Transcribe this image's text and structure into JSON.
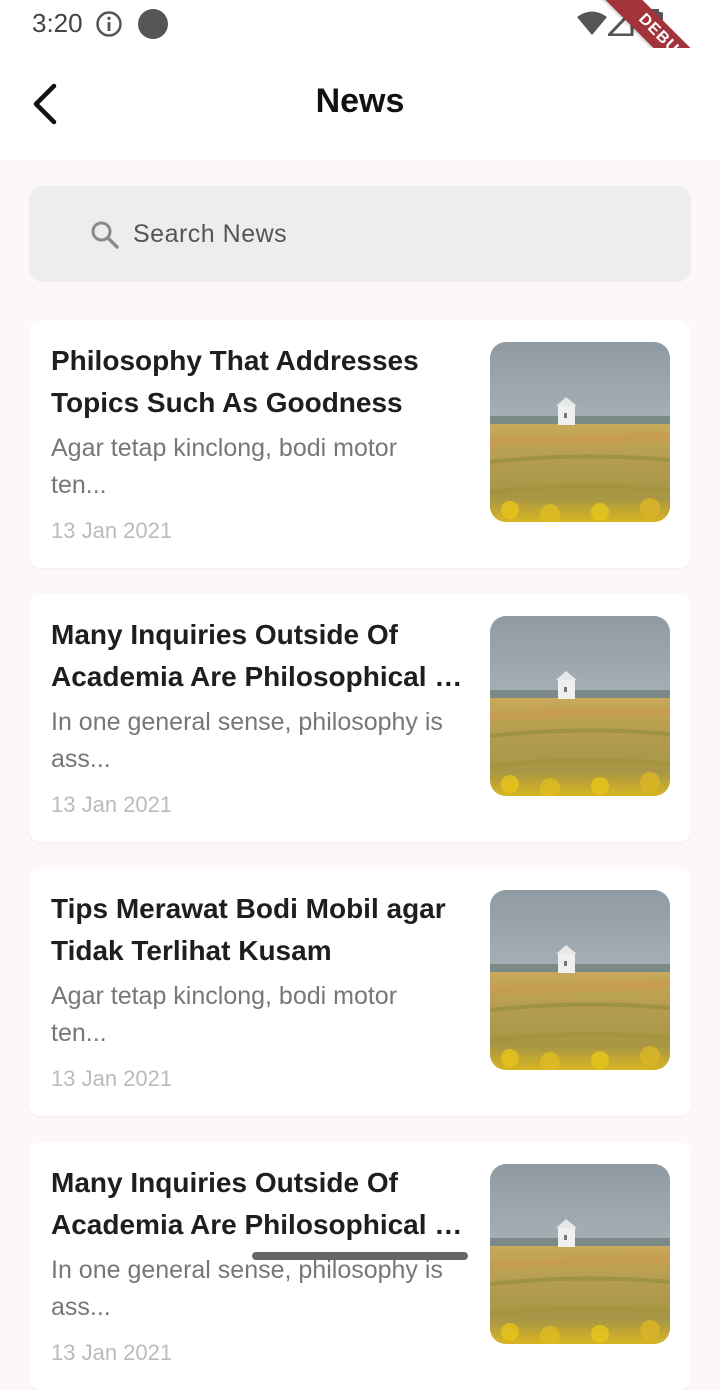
{
  "status_bar": {
    "time": "3:20"
  },
  "debug_banner": "DEBUG",
  "app_bar": {
    "title": "News"
  },
  "search": {
    "placeholder": "Search News"
  },
  "articles": [
    {
      "title_line1": "Philosophy That Addresses",
      "title_line2": "Topics Such As Goodness",
      "summary_line1": "Agar tetap kinclong, bodi motor",
      "summary_line2": "ten...",
      "date": "13 Jan 2021"
    },
    {
      "title_line1": "Many Inquiries Outside Of",
      "title_line2": "Academia Are Philosophical I…",
      "summary_line1": "In one general sense, philosophy is",
      "summary_line2": "ass...",
      "date": "13 Jan 2021"
    },
    {
      "title_line1": "Tips Merawat Bodi Mobil agar",
      "title_line2": "Tidak Terlihat Kusam",
      "summary_line1": "Agar tetap kinclong, bodi motor",
      "summary_line2": "ten...",
      "date": "13 Jan 2021"
    },
    {
      "title_line1": "Many Inquiries Outside Of",
      "title_line2": "Academia Are Philosophical I…",
      "summary_line1": "In one general sense, philosophy is",
      "summary_line2": "ass...",
      "date": "13 Jan 2021"
    }
  ]
}
